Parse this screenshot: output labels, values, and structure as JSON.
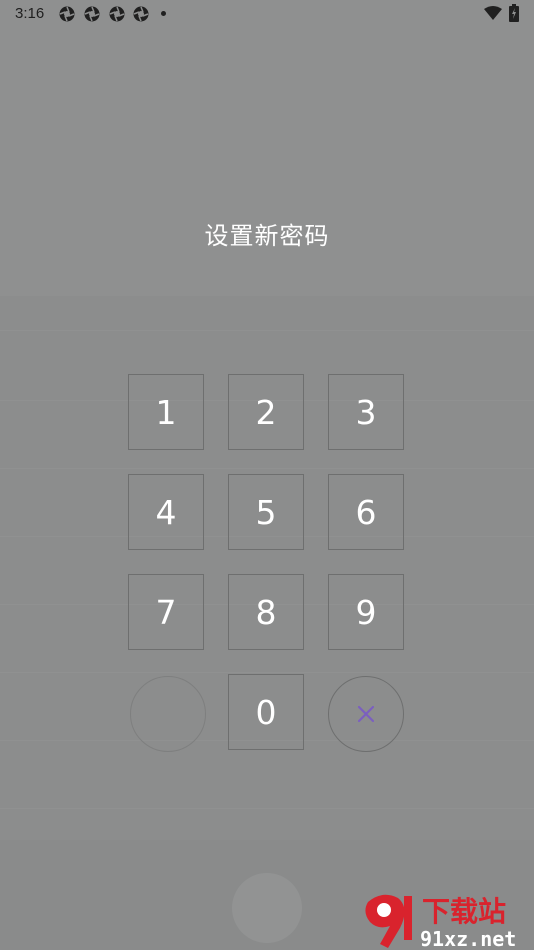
{
  "status_bar": {
    "time": "3:16",
    "notification_icons": [
      "app-notification-icon",
      "app-notification-icon",
      "app-notification-icon",
      "app-notification-icon"
    ],
    "wifi_icon": "wifi-icon",
    "battery_icon": "battery-charging-icon"
  },
  "dialog": {
    "title": "设置新密码"
  },
  "keypad": {
    "keys": [
      "1",
      "2",
      "3",
      "4",
      "5",
      "6",
      "7",
      "8",
      "9",
      "0"
    ],
    "delete_icon": "close-icon",
    "delete_color": "#7b5fc0"
  },
  "watermark": {
    "logo_text": "91",
    "brand_text": "下载站",
    "url_text": "91xz.net",
    "brand_color": "#d9232d"
  }
}
